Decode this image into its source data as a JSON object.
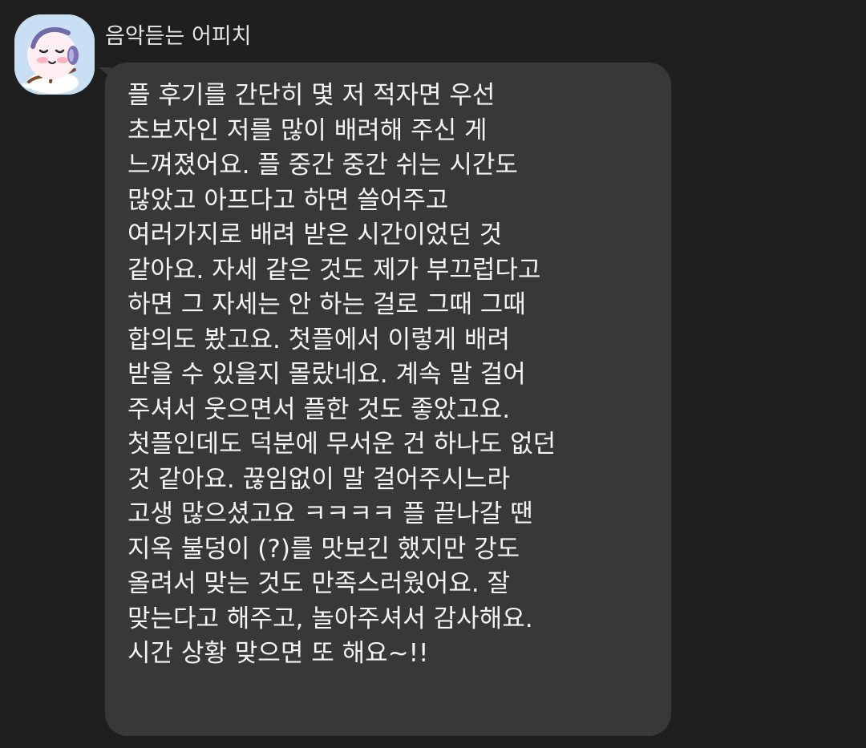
{
  "sender": {
    "name": "음악듣는 어피치",
    "avatar_icon": "apeach-headphones-icon"
  },
  "message": {
    "lines": [
      "플 후기를 간단히 몇 저 적자면 우선",
      "초보자인 저를 많이 배려해 주신 게",
      "느껴졌어요. 플 중간 중간 쉬는 시간도",
      "많았고 아프다고 하면 쓸어주고",
      "여러가지로 배려 받은 시간이었던 것",
      "같아요. 자세 같은 것도 제가 부끄럽다고",
      "하면 그 자세는 안 하는 걸로 그때 그때",
      "합의도 봤고요. 첫플에서 이렇게 배려",
      "받을 수 있을지 몰랐네요. 계속 말 걸어",
      "주셔서 웃으면서 플한 것도 좋았고요.",
      "첫플인데도 덕분에 무서운 건 하나도 없던",
      "것 같아요. 끊임없이 말 걸어주시느라",
      "고생 많으셨고요 ㅋㅋㅋㅋ 플 끝나갈 땐",
      "지옥 불덩이 (?)를 맛보긴 했지만 강도",
      "올려서 맞는 것도 만족스러웠어요. 잘",
      "맞는다고 해주고, 놀아주셔서 감사해요.",
      "시간 상황 맞으면 또 해요~!!"
    ]
  },
  "colors": {
    "background": "#1f1f1f",
    "bubble": "#383838",
    "text": "#f4f4f4",
    "avatar_background": "#c9dff3"
  }
}
